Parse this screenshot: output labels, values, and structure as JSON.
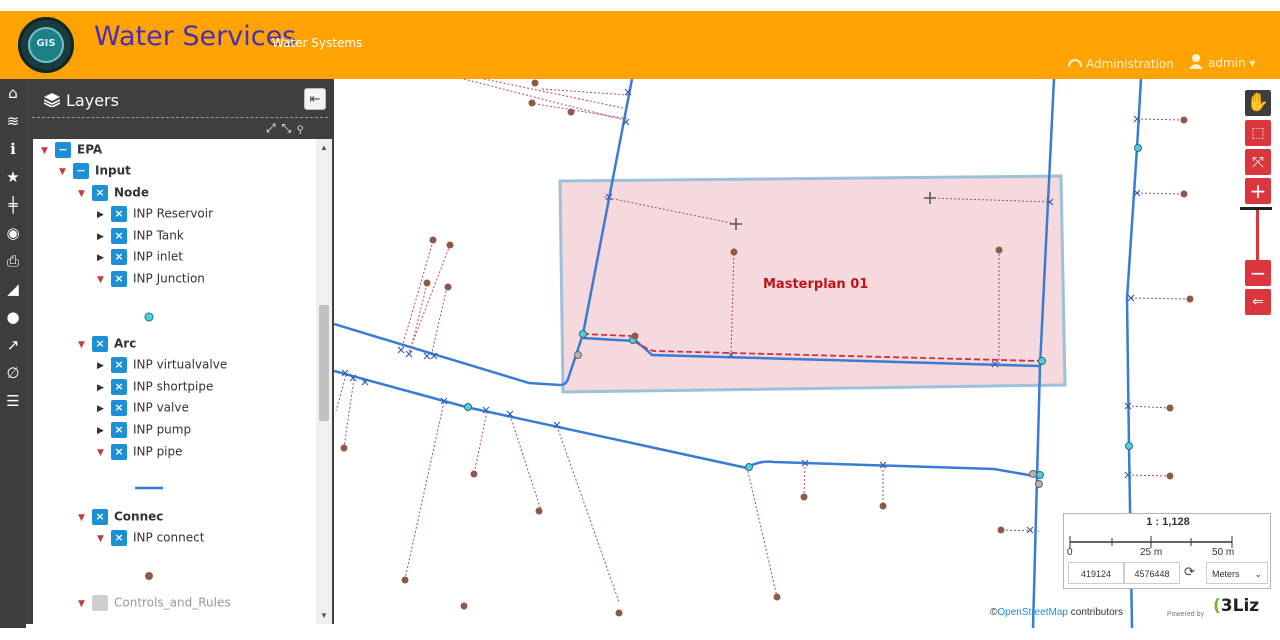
{
  "header": {
    "logo_text": "GIS",
    "title": "Water Services",
    "subtitle": "Water Systems",
    "administration_label": "Administration",
    "user_label": "admin ▾"
  },
  "toolbar": {
    "items": [
      "home-icon",
      "layers-icon",
      "info-icon",
      "star-icon",
      "split-icon",
      "target-icon",
      "print-icon",
      "ruler-icon",
      "comment-icon",
      "share-icon",
      "link-icon",
      "list-icon"
    ]
  },
  "layers_panel": {
    "title": "Layers",
    "tree": [
      {
        "label": "EPA",
        "level": 0,
        "checked": "minus",
        "open": true,
        "bold": true
      },
      {
        "label": "Input",
        "level": 1,
        "checked": "minus",
        "open": true,
        "bold": true
      },
      {
        "label": "Node",
        "level": 2,
        "checked": "x",
        "open": true,
        "bold": true
      },
      {
        "label": "INP Reservoir",
        "level": 3,
        "checked": "x",
        "open": false
      },
      {
        "label": "INP Tank",
        "level": 3,
        "checked": "x",
        "open": false
      },
      {
        "label": "INP inlet",
        "level": 3,
        "checked": "x",
        "open": false
      },
      {
        "label": "INP Junction",
        "level": 3,
        "checked": "x",
        "open": true
      },
      {
        "label": "Arc",
        "level": 2,
        "checked": "x",
        "open": true,
        "bold": true
      },
      {
        "label": "INP virtualvalve",
        "level": 3,
        "checked": "x",
        "open": false
      },
      {
        "label": "INP shortpipe",
        "level": 3,
        "checked": "x",
        "open": false
      },
      {
        "label": "INP valve",
        "level": 3,
        "checked": "x",
        "open": false
      },
      {
        "label": "INP pump",
        "level": 3,
        "checked": "x",
        "open": false
      },
      {
        "label": "INP pipe",
        "level": 3,
        "checked": "x",
        "open": true
      },
      {
        "label": "Connec",
        "level": 2,
        "checked": "x",
        "open": true,
        "bold": true
      },
      {
        "label": "INP connect",
        "level": 3,
        "checked": "x",
        "open": true
      },
      {
        "label": "Controls_and_Rules",
        "level": 2,
        "checked": "off",
        "open": true,
        "muted": true
      }
    ],
    "legend_colors": {
      "junction": "#4fd0e0",
      "pipe": "#3a7bd5",
      "connec": "#8d5a4a"
    }
  },
  "map": {
    "masterplan_label": "Masterplan 01",
    "colors": {
      "pipe": "#3a7bd5",
      "connec_line": "#b24a6a",
      "node": "#4fd0e0",
      "connec": "#8d5a4a",
      "masterplan_fill": "#f6d9dc",
      "masterplan_stroke": "#9dc1dd",
      "masterplan_text": "#c0121b",
      "planned_pipe": "#d03040"
    }
  },
  "scale": {
    "ratio": "1 : 1,128",
    "ticks": [
      "0",
      "25 m",
      "50 m"
    ],
    "x_coord": "419124",
    "y_coord": "4576448",
    "unit": "Meters"
  },
  "attribution": {
    "prefix": "©",
    "osm": "OpenStreetMap",
    "suffix": " contributors",
    "powered": "Powered by",
    "logo": "3Liz"
  },
  "colors": {
    "header": "#ffa302",
    "title": "#4a2fb3",
    "toolbar": "#3d3d3d",
    "control_red": "#d9363e",
    "checkbox": "#1c8fd6"
  }
}
